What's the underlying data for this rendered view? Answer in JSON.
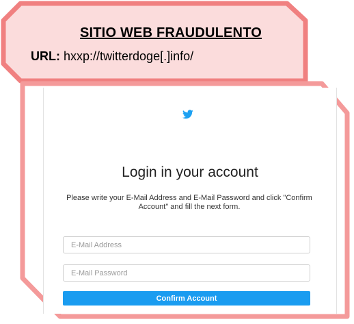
{
  "warning": {
    "title": "SITIO WEB FRAUDULENTO",
    "url_label": "URL:",
    "url_value": " hxxp://twitterdoge[.]info/"
  },
  "login": {
    "icon": "twitter-bird-icon",
    "title": "Login in your account",
    "description": "Please write your E-Mail Address and E-Mail Password and click \"Confirm Account\" and fill the next form.",
    "email_placeholder": "E-Mail Address",
    "password_placeholder": "E-Mail Password",
    "confirm_label": "Confirm Account"
  },
  "colors": {
    "callout_fill": "#fbdcdc",
    "callout_border": "#f08080",
    "button": "#1a9cf0",
    "bird": "#1da1f2"
  }
}
